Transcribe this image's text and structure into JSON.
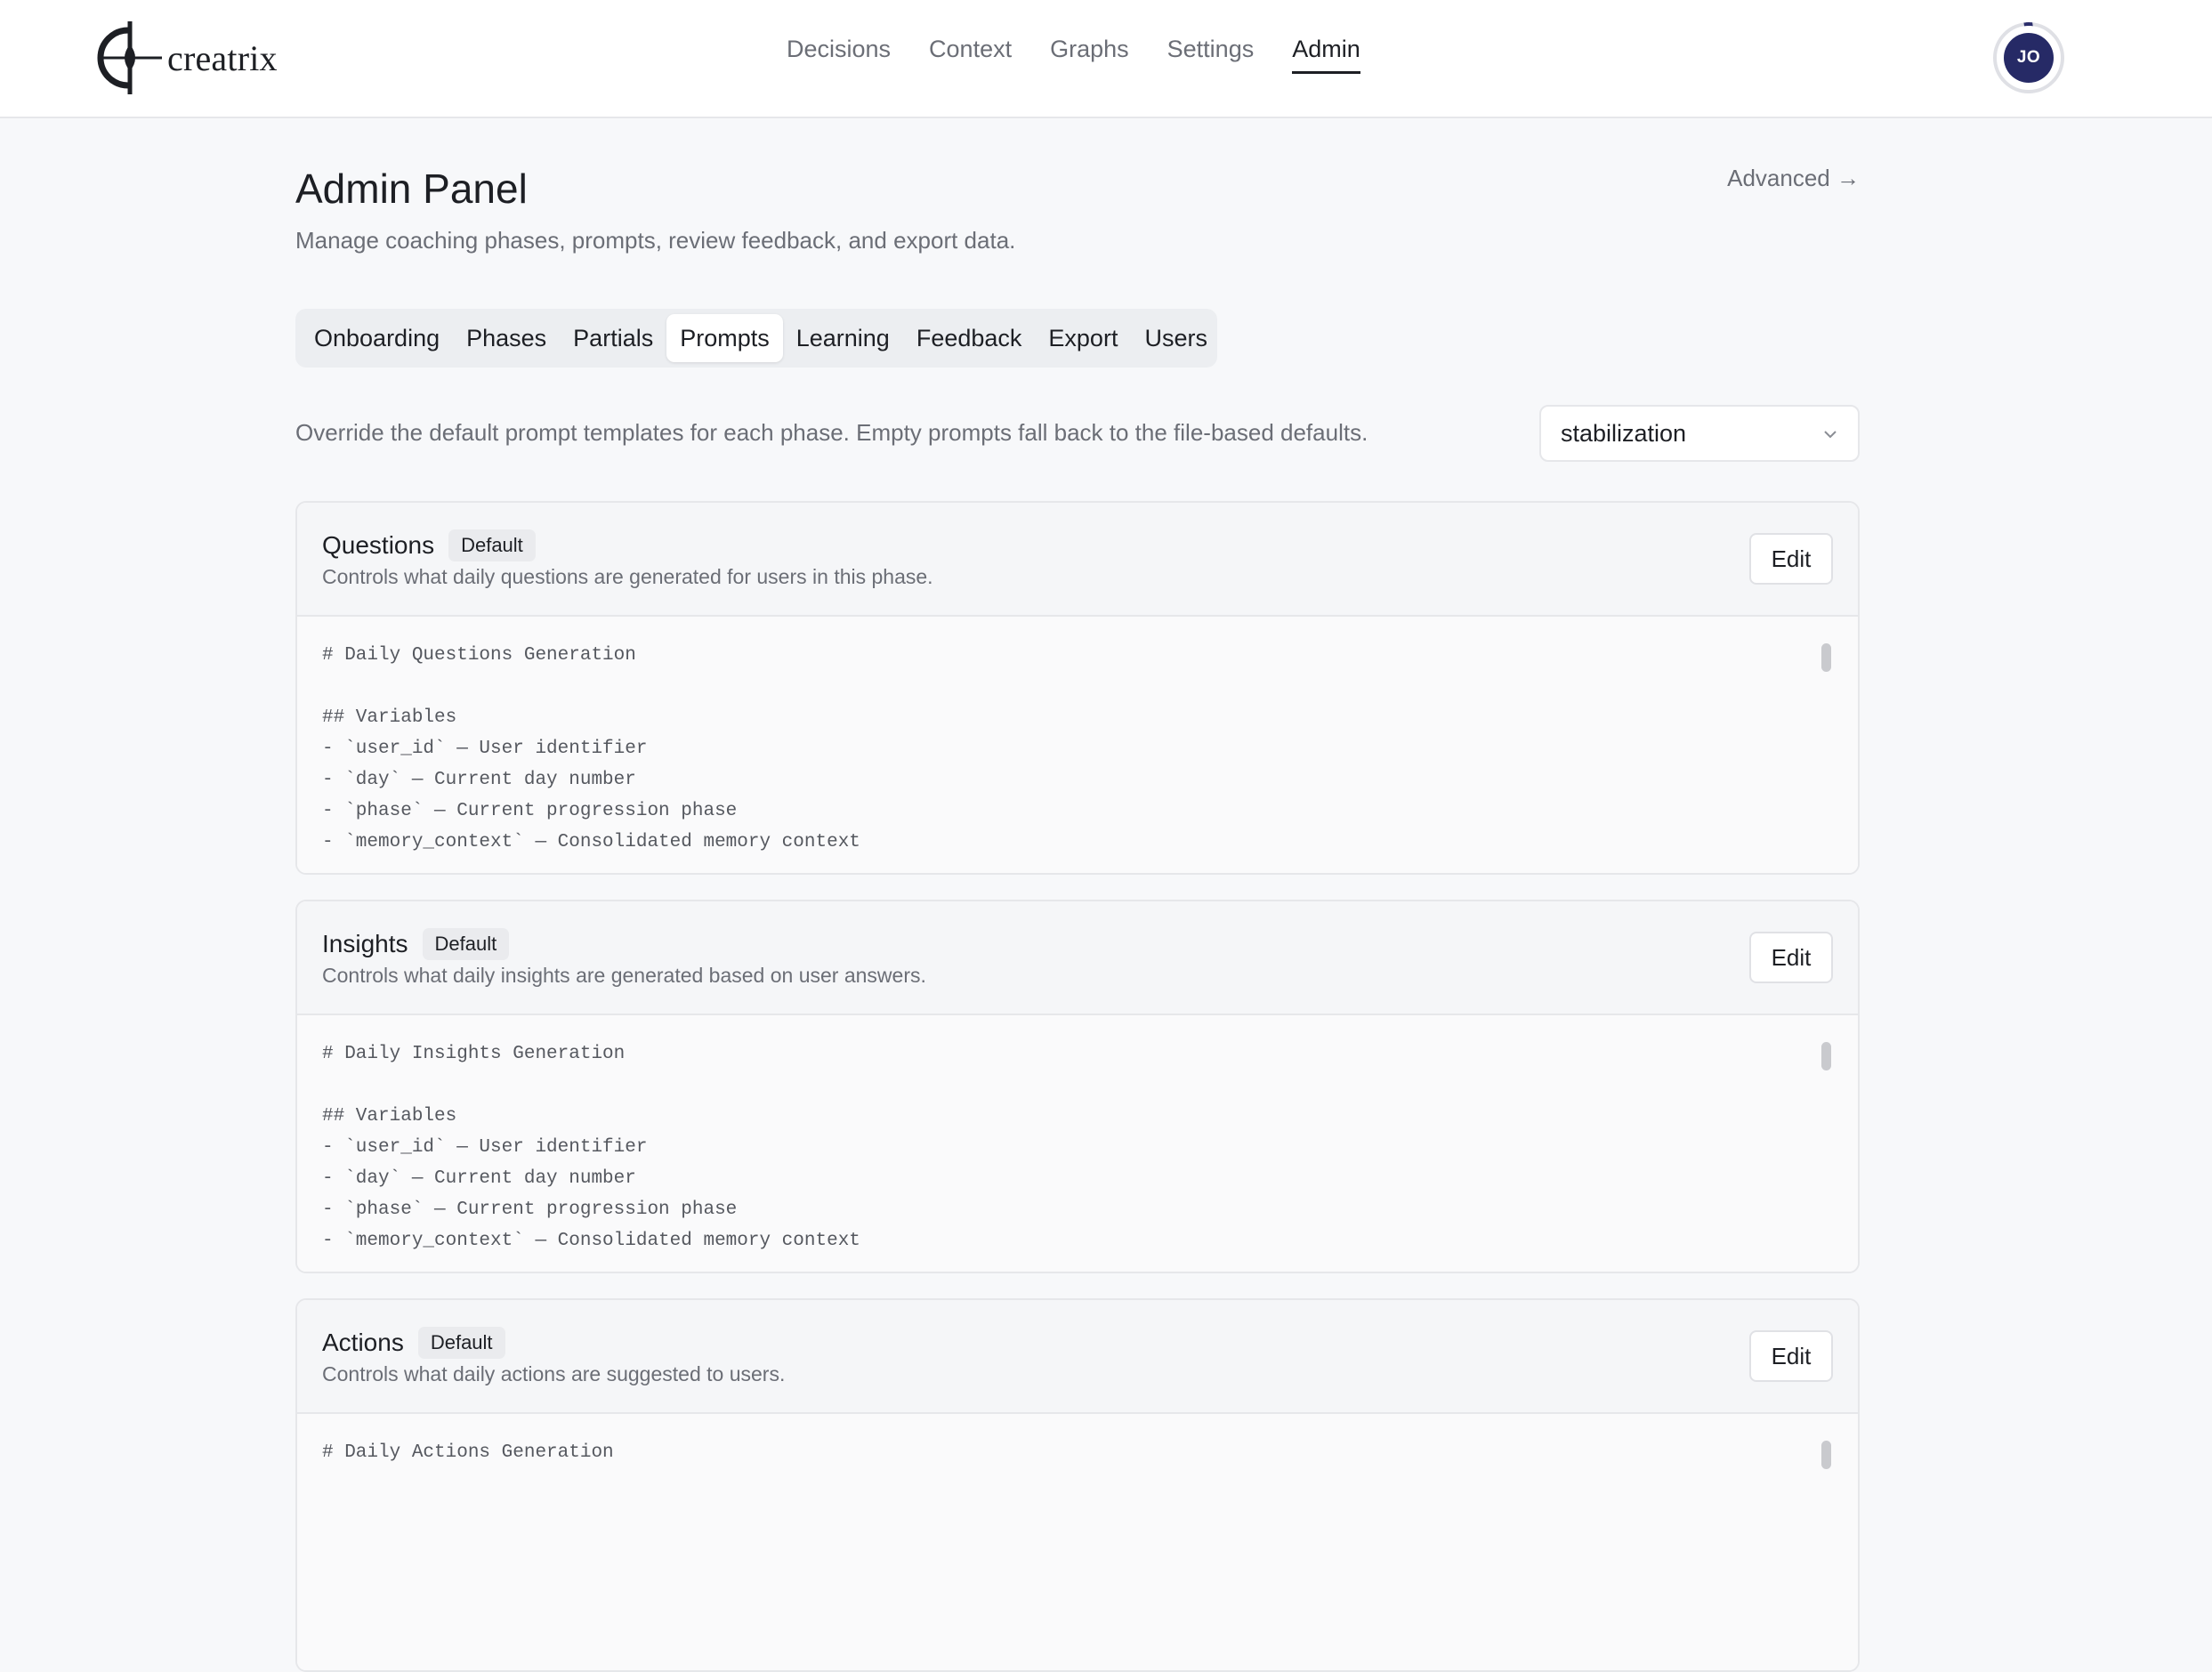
{
  "header": {
    "logo_text": "creatrix",
    "nav": [
      {
        "label": "Decisions",
        "active": false
      },
      {
        "label": "Context",
        "active": false
      },
      {
        "label": "Graphs",
        "active": false
      },
      {
        "label": "Settings",
        "active": false
      },
      {
        "label": "Admin",
        "active": true
      }
    ],
    "avatar_initials": "JO"
  },
  "page": {
    "title": "Admin Panel",
    "subtitle": "Manage coaching phases, prompts, review feedback, and export data.",
    "advanced_link": "Advanced →"
  },
  "tabs": [
    {
      "label": "Onboarding",
      "active": false
    },
    {
      "label": "Phases",
      "active": false
    },
    {
      "label": "Partials",
      "active": false
    },
    {
      "label": "Prompts",
      "active": true
    },
    {
      "label": "Learning",
      "active": false
    },
    {
      "label": "Feedback",
      "active": false
    },
    {
      "label": "Export",
      "active": false
    },
    {
      "label": "Users",
      "active": false
    }
  ],
  "prompts": {
    "description": "Override the default prompt templates for each phase. Empty prompts fall back to the file-based defaults.",
    "phase_select": "stabilization",
    "cards": [
      {
        "title": "Questions",
        "badge": "Default",
        "subtitle": "Controls what daily questions are generated for users in this phase.",
        "edit_label": "Edit",
        "code": "# Daily Questions Generation\n\n## Variables\n- `user_id` — User identifier\n- `day` — Current day number\n- `phase` — Current progression phase\n- `memory_context` — Consolidated memory context"
      },
      {
        "title": "Insights",
        "badge": "Default",
        "subtitle": "Controls what daily insights are generated based on user answers.",
        "edit_label": "Edit",
        "code": "# Daily Insights Generation\n\n## Variables\n- `user_id` — User identifier\n- `day` — Current day number\n- `phase` — Current progression phase\n- `memory_context` — Consolidated memory context"
      },
      {
        "title": "Actions",
        "badge": "Default",
        "subtitle": "Controls what daily actions are suggested to users.",
        "edit_label": "Edit",
        "code": "# Daily Actions Generation"
      }
    ]
  }
}
